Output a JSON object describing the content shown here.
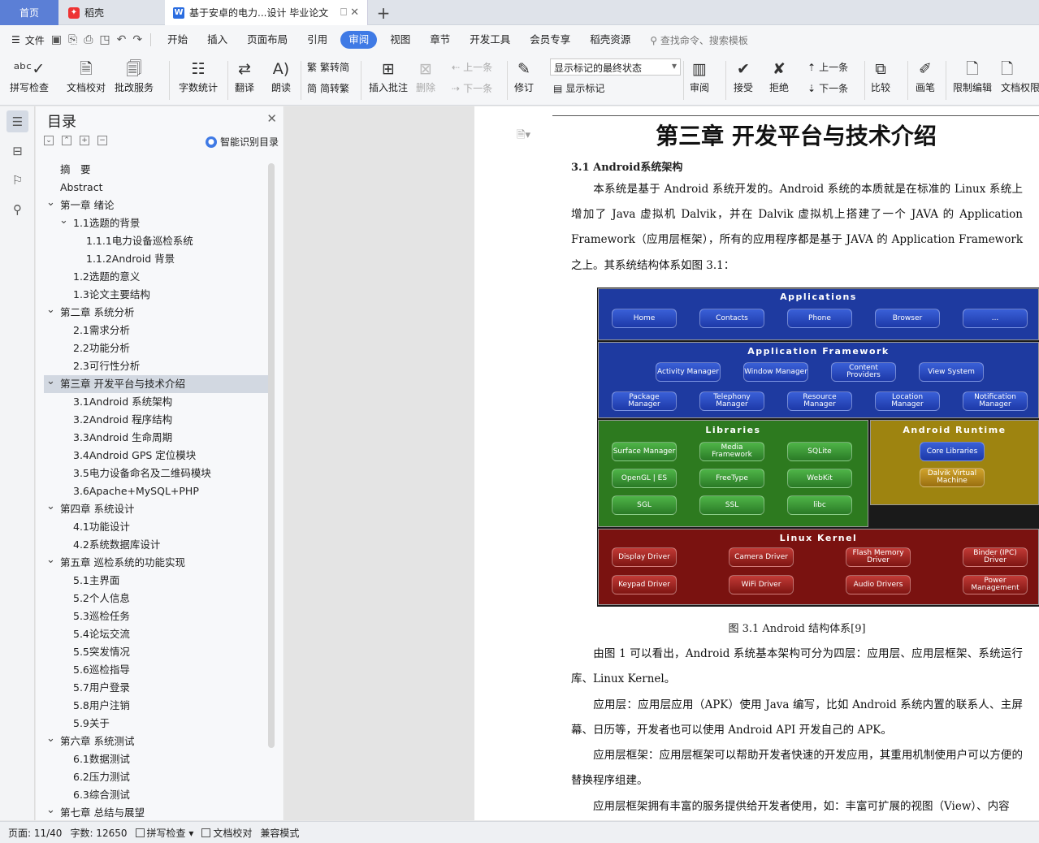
{
  "tabs": {
    "home": "首页",
    "daoke": "稻壳",
    "doc": "基于安卓的电力...设计 毕业论文",
    "add": "+"
  },
  "menu": {
    "file": "文件",
    "items": [
      "开始",
      "插入",
      "页面布局",
      "引用",
      "审阅",
      "视图",
      "章节",
      "开发工具",
      "会员专享",
      "稻壳资源"
    ],
    "active_index": 4,
    "search": "查找命令、搜索模板"
  },
  "ribbon": {
    "spell": "拼写检查",
    "proof": "文档校对",
    "batch": "批改服务",
    "wordcount": "字数统计",
    "translate": "翻译",
    "read": "朗读",
    "trad": "繁转简",
    "simp": "简转繁",
    "insert_comment": "插入批注",
    "delete": "删除",
    "prev_comment": "上一条",
    "next_comment": "下一条",
    "revise": "修订",
    "markup_state": "显示标记的最终状态",
    "show_markup": "显示标记",
    "review": "审阅",
    "accept": "接受",
    "reject": "拒绝",
    "prev_change": "上一条",
    "next_change": "下一条",
    "compare": "比较",
    "pen": "画笔",
    "restrict": "限制编辑",
    "doc_perm": "文档权限"
  },
  "toc": {
    "title": "目录",
    "smart": "智能识别目录",
    "items": [
      {
        "text": "摘　要",
        "level": 0,
        "arrow": ""
      },
      {
        "text": "Abstract",
        "level": 0,
        "arrow": ""
      },
      {
        "text": "第一章  绪论",
        "level": 0,
        "arrow": "v"
      },
      {
        "text": "1.1选题的背景",
        "level": 1,
        "arrow": "v"
      },
      {
        "text": "1.1.1电力设备巡检系统",
        "level": 2,
        "arrow": ""
      },
      {
        "text": "1.1.2Android 背景",
        "level": 2,
        "arrow": ""
      },
      {
        "text": "1.2选题的意义",
        "level": 1,
        "arrow": ""
      },
      {
        "text": "1.3论文主要结构",
        "level": 1,
        "arrow": ""
      },
      {
        "text": "第二章  系统分析",
        "level": 0,
        "arrow": "v"
      },
      {
        "text": "2.1需求分析",
        "level": 1,
        "arrow": ""
      },
      {
        "text": "2.2功能分析",
        "level": 1,
        "arrow": ""
      },
      {
        "text": "2.3可行性分析",
        "level": 1,
        "arrow": ""
      },
      {
        "text": "第三章  开发平台与技术介绍",
        "level": 0,
        "arrow": "v",
        "selected": true
      },
      {
        "text": "3.1Android 系统架构",
        "level": 1,
        "arrow": ""
      },
      {
        "text": "3.2Android 程序结构",
        "level": 1,
        "arrow": ""
      },
      {
        "text": "3.3Android 生命周期",
        "level": 1,
        "arrow": ""
      },
      {
        "text": "3.4Android GPS 定位模块",
        "level": 1,
        "arrow": ""
      },
      {
        "text": "3.5电力设备命名及二维码模块",
        "level": 1,
        "arrow": ""
      },
      {
        "text": "3.6Apache+MySQL+PHP",
        "level": 1,
        "arrow": ""
      },
      {
        "text": "第四章  系统设计",
        "level": 0,
        "arrow": "v"
      },
      {
        "text": "4.1功能设计",
        "level": 1,
        "arrow": ""
      },
      {
        "text": "4.2系统数据库设计",
        "level": 1,
        "arrow": ""
      },
      {
        "text": "第五章  巡检系统的功能实现",
        "level": 0,
        "arrow": "v"
      },
      {
        "text": "5.1主界面",
        "level": 1,
        "arrow": ""
      },
      {
        "text": "5.2个人信息",
        "level": 1,
        "arrow": ""
      },
      {
        "text": "5.3巡检任务",
        "level": 1,
        "arrow": ""
      },
      {
        "text": "5.4论坛交流",
        "level": 1,
        "arrow": ""
      },
      {
        "text": "5.5突发情况",
        "level": 1,
        "arrow": ""
      },
      {
        "text": "5.6巡检指导",
        "level": 1,
        "arrow": ""
      },
      {
        "text": "5.7用户登录",
        "level": 1,
        "arrow": ""
      },
      {
        "text": "5.8用户注销",
        "level": 1,
        "arrow": ""
      },
      {
        "text": "5.9关于",
        "level": 1,
        "arrow": ""
      },
      {
        "text": "第六章  系统测试",
        "level": 0,
        "arrow": "v"
      },
      {
        "text": "6.1数据测试",
        "level": 1,
        "arrow": ""
      },
      {
        "text": "6.2压力测试",
        "level": 1,
        "arrow": ""
      },
      {
        "text": "6.3综合测试",
        "level": 1,
        "arrow": ""
      },
      {
        "text": "第七章  总结与展望",
        "level": 0,
        "arrow": "v"
      }
    ]
  },
  "doc": {
    "chapter": "第三章  开发平台与技术介绍",
    "section": "3.1 Android系统架构",
    "p1": "本系统是基于 Android 系统开发的。Android 系统的本质就是在标准的 Linux 系统上增加了 Java 虚拟机 Dalvik，并在 Dalvik 虚拟机上搭建了一个 JAVA 的 Application Framework（应用层框架），所有的应用程序都是基于 JAVA 的 Application Framework 之上。其系统结构体系如图 3.1：",
    "fig_caption": "图 3.1   Android 结构体系[9]",
    "p2": "由图 1 可以看出，Android 系统基本架构可分为四层：应用层、应用层框架、系统运行库、Linux Kernel。",
    "p3": "应用层：应用层应用（APK）使用 Java 编写，比如 Android 系统内置的联系人、主屏幕、日历等，开发者也可以使用 Android API 开发自己的 APK。",
    "p4": "应用层框架：应用层框架可以帮助开发者快速的开发应用，其重用机制使用户可以方便的替换程序组建。",
    "p5": "应用层框架拥有丰富的服务提供给开发者使用，如：丰富可扩展的视图（View）、内容"
  },
  "arch": {
    "applications": {
      "title": "Applications",
      "items": [
        "Home",
        "Contacts",
        "Phone",
        "Browser",
        "..."
      ]
    },
    "framework": {
      "title": "Application Framework",
      "row1": [
        "Activity Manager",
        "Window Manager",
        "Content Providers",
        "View System"
      ],
      "row2": [
        "Package Manager",
        "Telephony Manager",
        "Resource Manager",
        "Location Manager",
        "Notification Manager"
      ]
    },
    "libraries": {
      "title": "Libraries",
      "items": [
        "Surface Manager",
        "Media Framework",
        "SQLite",
        "OpenGL | ES",
        "FreeType",
        "WebKit",
        "SGL",
        "SSL",
        "libc"
      ]
    },
    "runtime": {
      "title": "Android Runtime",
      "items": [
        "Core Libraries",
        "Dalvik Virtual Machine"
      ]
    },
    "kernel": {
      "title": "Linux Kernel",
      "items": [
        "Display Driver",
        "Camera Driver",
        "Flash Memory Driver",
        "Binder (IPC) Driver",
        "Keypad Driver",
        "WiFi Driver",
        "Audio Drivers",
        "Power Management"
      ]
    }
  },
  "status": {
    "page": "页面: 11/40",
    "words": "字数: 12650",
    "spell": "拼写检查",
    "proof": "文档校对",
    "compat": "兼容模式"
  }
}
